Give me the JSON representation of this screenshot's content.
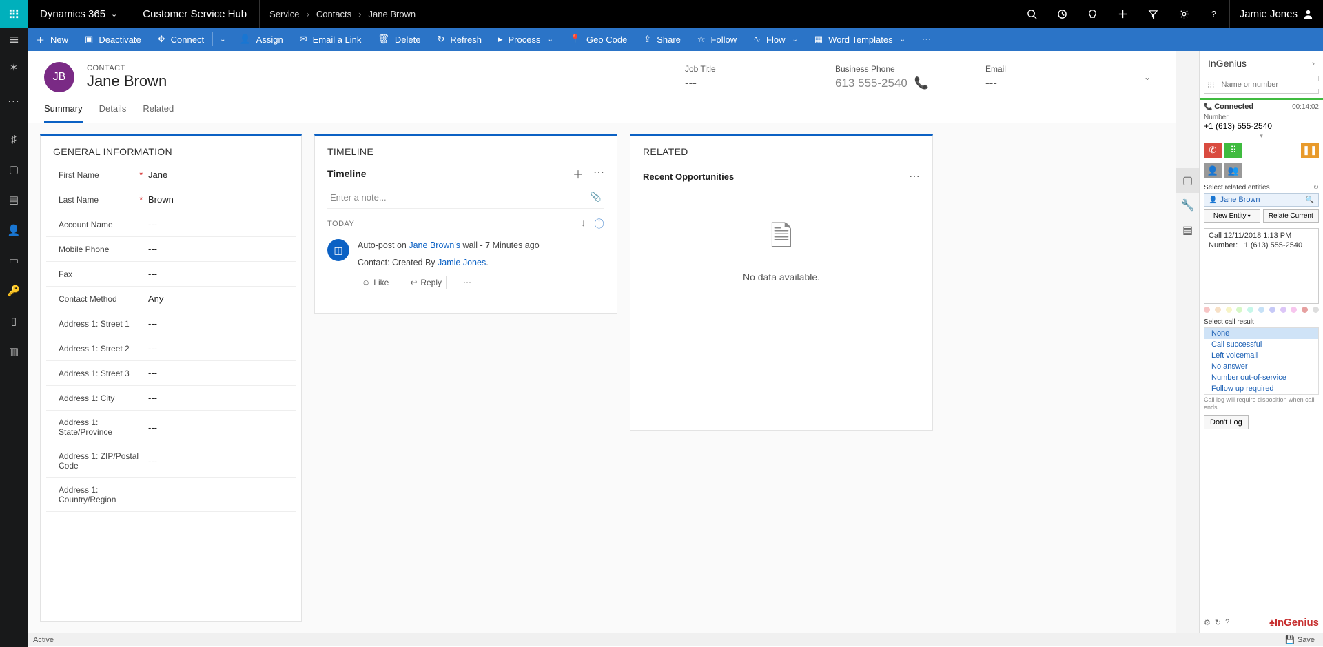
{
  "topbar": {
    "brand": "Dynamics 365",
    "hub": "Customer Service Hub",
    "crumbs": [
      "Service",
      "Contacts",
      "Jane Brown"
    ],
    "user": "Jamie Jones"
  },
  "cmdbar": {
    "new": "New",
    "deactivate": "Deactivate",
    "connect": "Connect",
    "assign": "Assign",
    "email": "Email a Link",
    "delete": "Delete",
    "refresh": "Refresh",
    "process": "Process",
    "geocode": "Geo Code",
    "share": "Share",
    "follow": "Follow",
    "flow": "Flow",
    "templates": "Word Templates"
  },
  "contact": {
    "type": "CONTACT",
    "name": "Jane Brown",
    "initials": "JB",
    "jobTitleLabel": "Job Title",
    "jobTitle": "---",
    "phoneLabel": "Business Phone",
    "phone": "613 555-2540",
    "emailLabel": "Email",
    "email": "---"
  },
  "tabs": {
    "summary": "Summary",
    "details": "Details",
    "related": "Related"
  },
  "general": {
    "title": "GENERAL INFORMATION",
    "fields": [
      {
        "label": "First Name",
        "value": "Jane",
        "req": true
      },
      {
        "label": "Last Name",
        "value": "Brown",
        "req": true
      },
      {
        "label": "Account Name",
        "value": "---"
      },
      {
        "label": "Mobile Phone",
        "value": "---"
      },
      {
        "label": "Fax",
        "value": "---"
      },
      {
        "label": "Contact Method",
        "value": "Any"
      },
      {
        "label": "Address 1: Street 1",
        "value": "---"
      },
      {
        "label": "Address 1: Street 2",
        "value": "---"
      },
      {
        "label": "Address 1: Street 3",
        "value": "---"
      },
      {
        "label": "Address 1: City",
        "value": "---"
      },
      {
        "label": "Address 1: State/Province",
        "value": "---"
      },
      {
        "label": "Address 1: ZIP/Postal Code",
        "value": "---"
      },
      {
        "label": "Address 1: Country/Region",
        "value": ""
      }
    ]
  },
  "timeline": {
    "title": "TIMELINE",
    "subtitle": "Timeline",
    "placeholder": "Enter a note...",
    "today": "TODAY",
    "post_prefix": "Auto-post on ",
    "post_name": "Jane Brown's",
    "post_suffix": " wall - ",
    "post_time": "7 Minutes ago",
    "post_body_prefix": "Contact: Created By ",
    "post_body_name": "Jamie Jones",
    "like": "Like",
    "reply": "Reply"
  },
  "related": {
    "title": "RELATED",
    "subtitle": "Recent Opportunities",
    "nodata": "No data available."
  },
  "panel": {
    "title": "InGenius",
    "search_placeholder": "Name or number",
    "status": "Connected",
    "duration": "00:14:02",
    "numlabel": "Number",
    "number": "+1 (613) 555-2540",
    "selrel": "Select related entities",
    "relname": "Jane Brown",
    "newentity": "New Entity",
    "relatecurrent": "Relate Current",
    "calltime": "Call 12/11/2018 1:13 PM",
    "callnum": "Number: +1 (613) 555-2540",
    "selresult": "Select call result",
    "results": [
      "None",
      "Call successful",
      "Left voicemail",
      "No answer",
      "Number out-of-service",
      "Follow up required"
    ],
    "hint": "Call log will require disposition when call ends.",
    "dontlog": "Don't Log",
    "logo": "InGenius"
  },
  "status": {
    "active": "Active",
    "save": "Save"
  }
}
